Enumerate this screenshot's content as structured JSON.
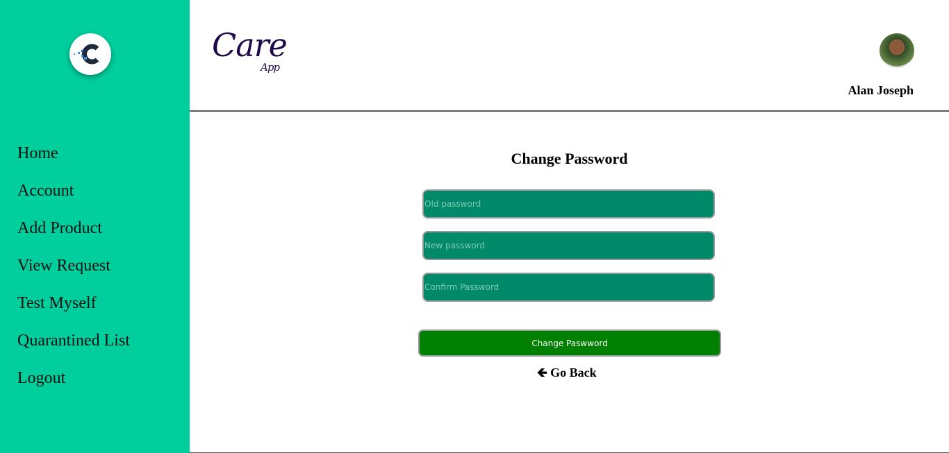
{
  "sidebar": {
    "items": [
      {
        "label": "Home"
      },
      {
        "label": "Account"
      },
      {
        "label": "Add Product"
      },
      {
        "label": "View Request"
      },
      {
        "label": "Test Myself"
      },
      {
        "label": "Quarantined List"
      },
      {
        "label": "Logout"
      }
    ]
  },
  "header": {
    "brand": "Care",
    "brand_sub": "App",
    "user_name": "Alan Joseph"
  },
  "form": {
    "title": "Change Password",
    "old_placeholder": "Old password",
    "new_placeholder": "New password",
    "confirm_placeholder": "Confirm Password",
    "submit_label": "Change Paswword",
    "back_label": "Go Back"
  }
}
